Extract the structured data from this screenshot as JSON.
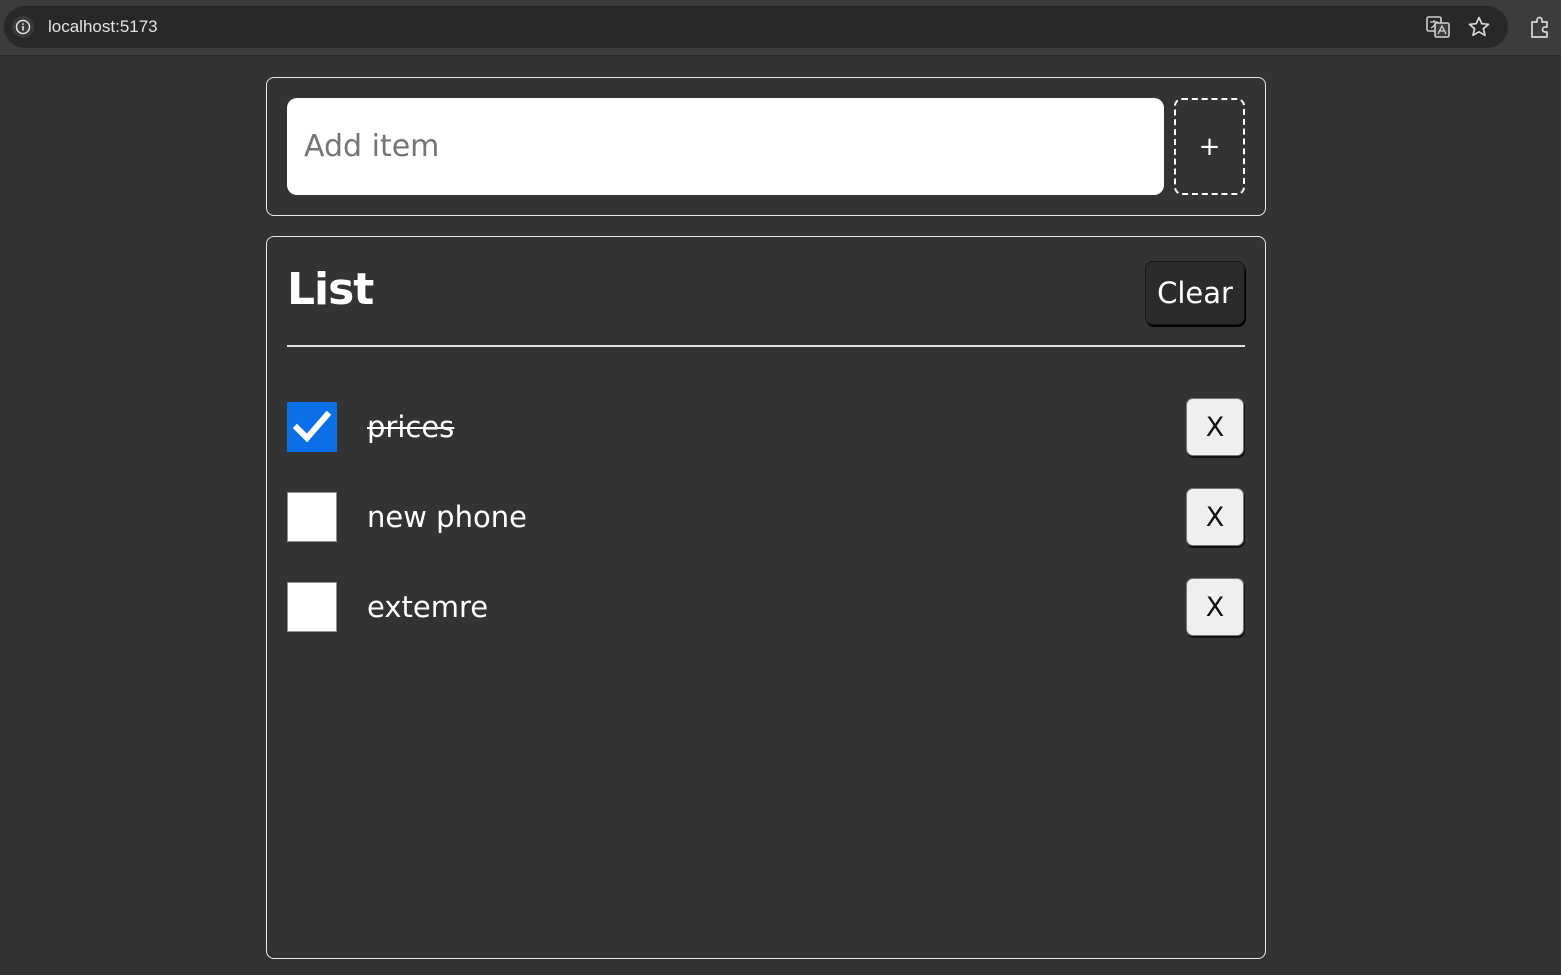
{
  "browser": {
    "url": "localhost:5173",
    "icons": [
      "info-icon",
      "translate-icon",
      "star-icon",
      "extensions-icon"
    ]
  },
  "add_form": {
    "input_value": "",
    "input_placeholder": "Add item",
    "add_button_label": "+"
  },
  "list": {
    "title": "List",
    "clear_label": "Clear",
    "items": [
      {
        "label": "prices",
        "checked": true,
        "remove_label": "X"
      },
      {
        "label": "new phone",
        "checked": false,
        "remove_label": "X"
      },
      {
        "label": "extemre",
        "checked": false,
        "remove_label": "X"
      }
    ]
  },
  "colors": {
    "background": "#333333",
    "card_border": "#e8e8e8",
    "checkbox_checked": "#0b6fe8",
    "text": "#ffffff"
  }
}
